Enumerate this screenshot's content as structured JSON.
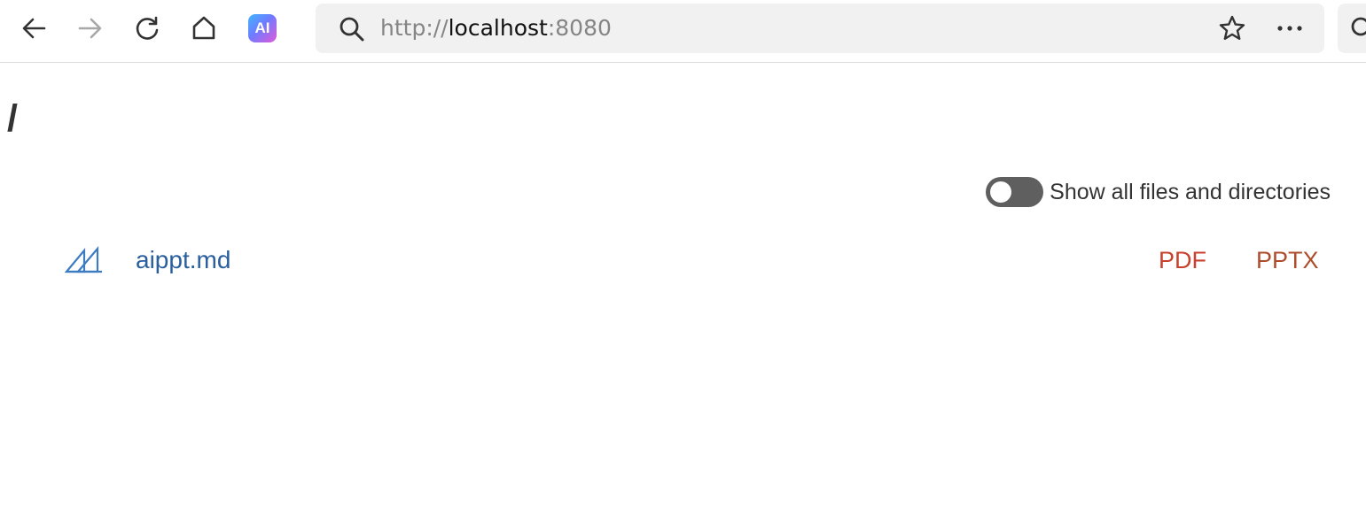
{
  "browser": {
    "url": {
      "scheme": "http://",
      "host": "localhost",
      "port": ":8080"
    },
    "ai_button_label": "AI",
    "icons": {
      "back": "arrow-left-icon",
      "forward": "arrow-right-icon",
      "reload": "reload-icon",
      "home": "home-icon",
      "ai": "ai-assistant-icon",
      "search": "search-icon",
      "favorite": "star-icon",
      "more": "more-dots-icon",
      "sidebar_search": "search-icon"
    },
    "forward_disabled": true
  },
  "page": {
    "title": "/",
    "toggle": {
      "label": "Show all files and directories",
      "on": false
    },
    "files": [
      {
        "name": "aippt.md",
        "icon": "markdown-icon",
        "actions": [
          "PDF",
          "PPTX"
        ]
      }
    ],
    "colors": {
      "link": "#2a5f9e",
      "pdf": "#c7412c",
      "pptx": "#ad4d2c",
      "toggle_off": "#5f5f5f"
    }
  }
}
